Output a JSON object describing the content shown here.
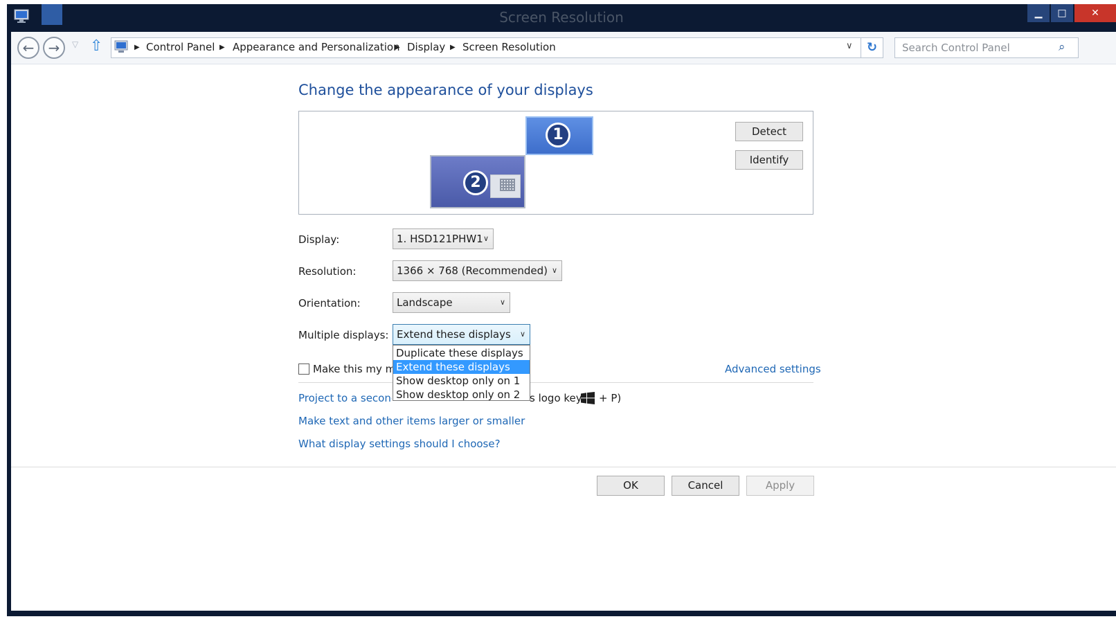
{
  "window": {
    "title": "Screen Resolution",
    "minimize": "▁",
    "maximize": "□",
    "close": "✕"
  },
  "nav": {
    "back": "←",
    "forward": "→",
    "history": "▽",
    "up": "⇧",
    "breadcrumb": [
      "Control Panel",
      "Appearance and Personalization",
      "Display",
      "Screen Resolution"
    ],
    "breadcrumb_separator": "▶",
    "address_dropdown": "∨",
    "refresh": "↻",
    "search_placeholder": "Search Control Panel",
    "search_icon": "⌕"
  },
  "content": {
    "title": "Change the appearance of your displays",
    "monitors": [
      {
        "number": "1",
        "selected": true
      },
      {
        "number": "2",
        "selected": false
      }
    ],
    "detect_label": "Detect",
    "identify_label": "Identify",
    "display_label": "Display:",
    "display_value": "1. HSD121PHW1",
    "resolution_label": "Resolution:",
    "resolution_value": "1366 × 768 (Recommended)",
    "orientation_label": "Orientation:",
    "orientation_value": "Landscape",
    "multiple_label": "Multiple displays:",
    "multiple_value": "Extend these displays",
    "multiple_options": [
      {
        "label": "Duplicate these displays",
        "selected": false
      },
      {
        "label": "Extend these displays",
        "selected": true
      },
      {
        "label": "Show desktop only on 1",
        "selected": false
      },
      {
        "label": "Show desktop only on 2",
        "selected": false
      }
    ],
    "main_display_checkbox_label": "Make this my ma",
    "main_display_checked": false,
    "advanced_link": "Advanced settings",
    "project_link": "Project to a second",
    "project_suffix_1": "s logo key",
    "project_suffix_2": "+ P)",
    "text_size_link": "Make text and other items larger or smaller",
    "help_link": "What display settings should I choose?",
    "dropdown_arrow": "∨"
  },
  "footer": {
    "ok": "OK",
    "cancel": "Cancel",
    "apply": "Apply",
    "apply_enabled": false
  },
  "colors": {
    "link": "#1e67b5",
    "title": "#1e4f9b",
    "selection": "#3399ff",
    "titlebar": "#0c1a33"
  }
}
